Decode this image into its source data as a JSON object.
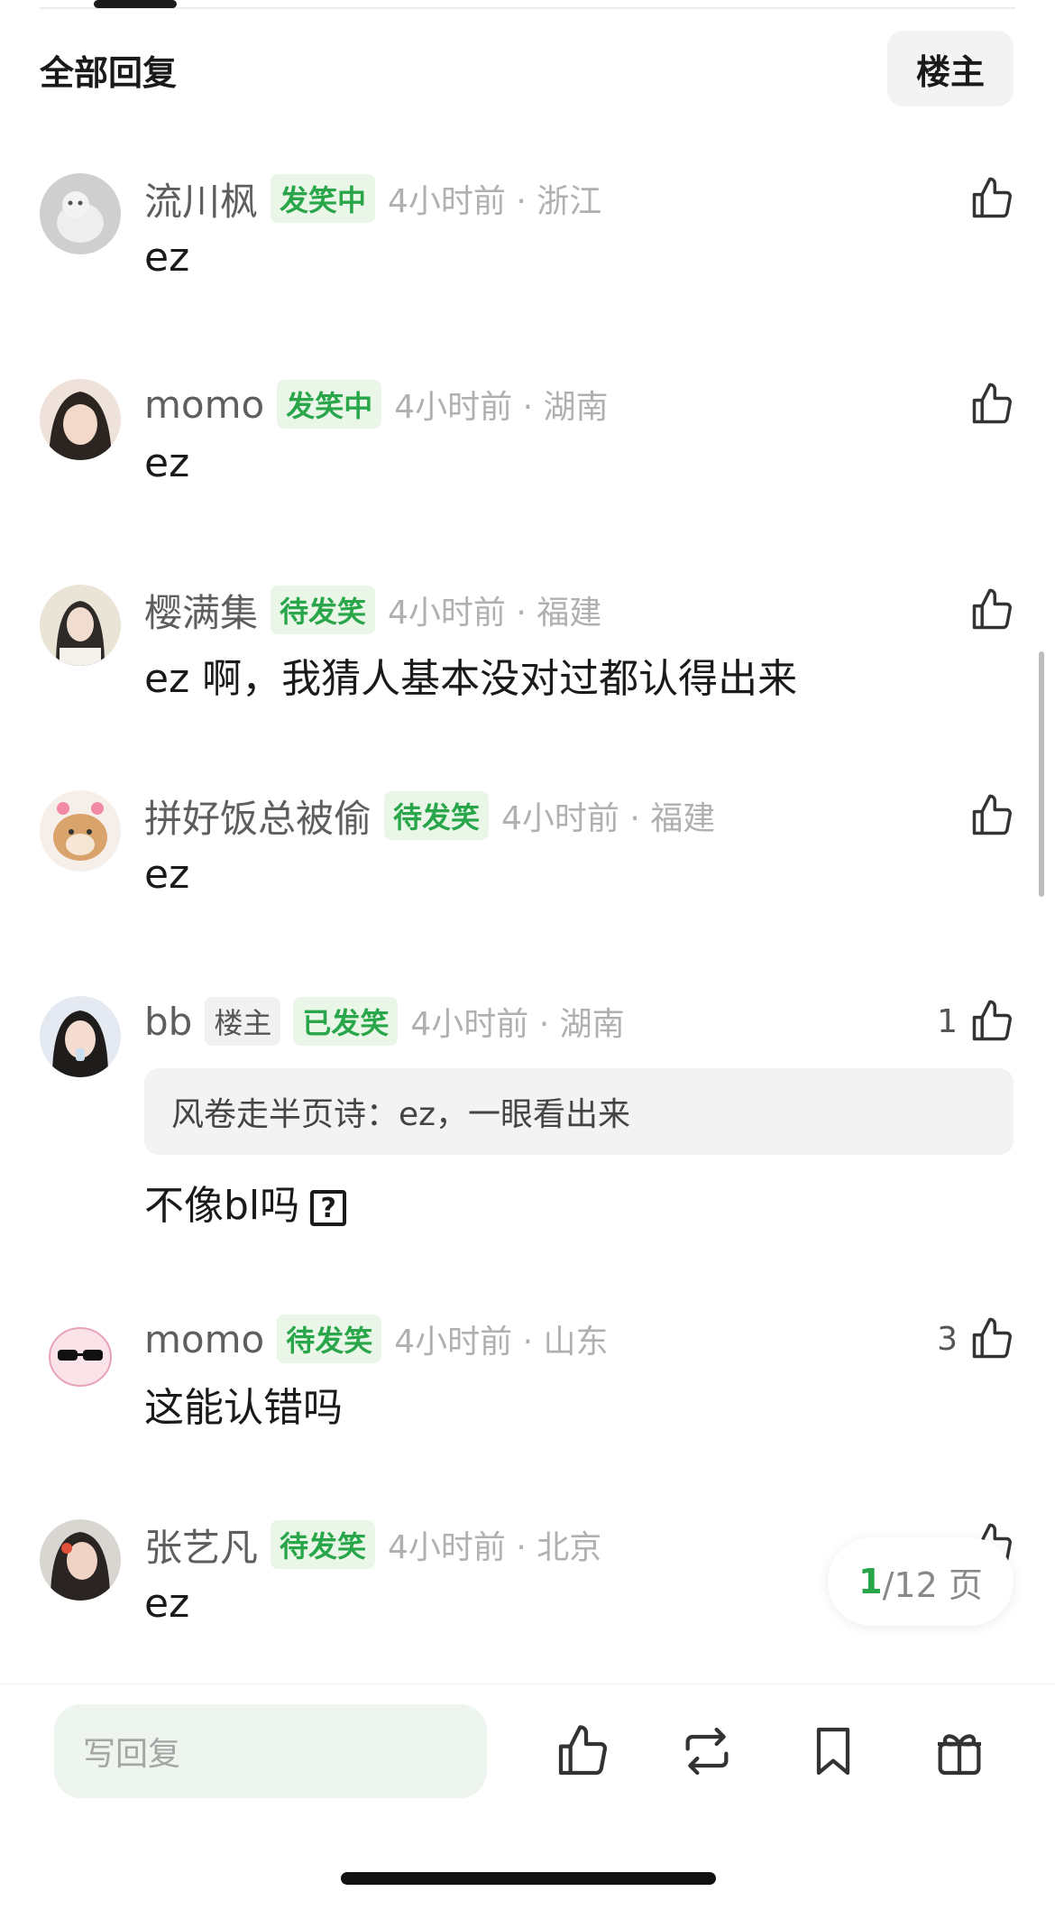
{
  "header": {
    "title": "全部回复",
    "filter_button": "楼主"
  },
  "comments": [
    {
      "username": "流川枫",
      "badges": [
        "发笑中"
      ],
      "time_location": "4小时前 · 浙江",
      "text": "ez",
      "likes": ""
    },
    {
      "username": "momo",
      "badges": [
        "发笑中"
      ],
      "time_location": "4小时前 · 湖南",
      "text": "ez",
      "likes": ""
    },
    {
      "username": "樱满集",
      "badges": [
        "待发笑"
      ],
      "time_location": "4小时前 · 福建",
      "text": "ez 啊，我猜人基本没对过都认得出来",
      "likes": ""
    },
    {
      "username": "拼好饭总被偷",
      "badges": [
        "待发笑"
      ],
      "time_location": "4小时前 · 福建",
      "text": "ez",
      "likes": ""
    },
    {
      "username": "bb",
      "badges": [
        "楼主",
        "已发笑"
      ],
      "time_location": "4小时前 · 湖南",
      "quote": "风卷走半页诗：ez，一眼看出来",
      "text": "不像bl吗",
      "likes": "1"
    },
    {
      "username": "momo",
      "badges": [
        "待发笑"
      ],
      "time_location": "4小时前 · 山东",
      "text": "这能认错吗",
      "likes": "3"
    },
    {
      "username": "张艺凡",
      "badges": [
        "待发笑"
      ],
      "time_location": "4小时前 · 北京",
      "text": "ez",
      "likes": ""
    }
  ],
  "pager": {
    "current": "1",
    "total_label": "/12 页"
  },
  "bottom_bar": {
    "reply_placeholder": "写回复"
  },
  "icons": {
    "like": "thumbs-up-icon",
    "repost": "repost-icon",
    "bookmark": "bookmark-icon",
    "gift": "gift-icon",
    "question": "question-mark-emoji"
  },
  "colors": {
    "accent_green": "#2aa64a",
    "badge_bg": "#eaf7e8",
    "muted_text": "#b0b0b0"
  }
}
